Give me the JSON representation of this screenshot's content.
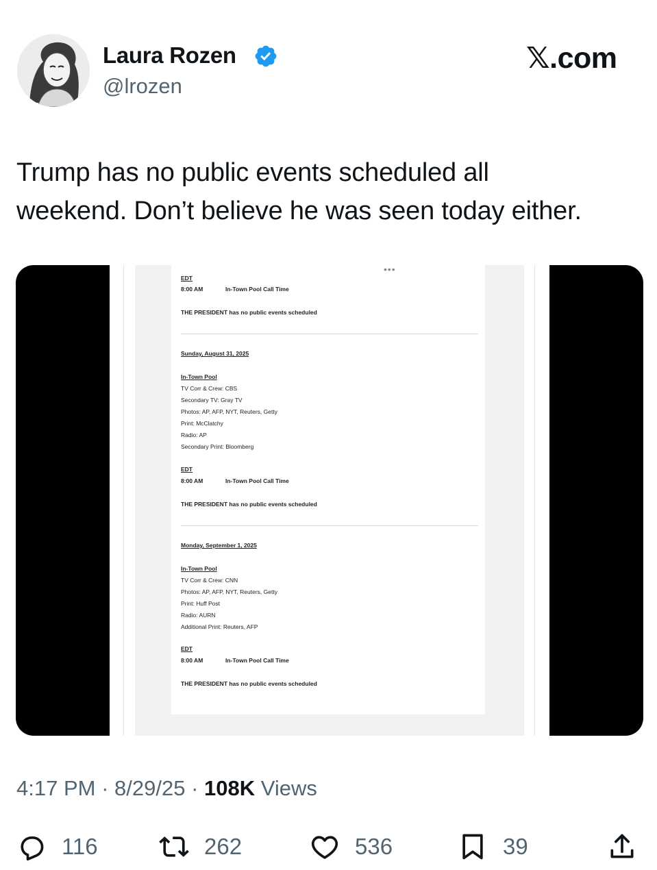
{
  "author": {
    "name": "Laura Rozen",
    "handle": "@lrozen",
    "verified_color": "#1d9bf0"
  },
  "brand": "𝕏.com",
  "tweet": {
    "text_line1": "Trump has no public events scheduled all",
    "text_line2": "weekend. Don’t believe he was seen today either."
  },
  "document": {
    "top": {
      "tz": "EDT",
      "time": "8:00 AM",
      "event": "In-Town Pool Call Time",
      "status": "THE PRESIDENT has no public events scheduled"
    },
    "sunday": {
      "date": "Sunday, August 31, 2025",
      "pool": "In-Town Pool",
      "lines": [
        "TV Corr & Crew: CBS",
        "Secondary TV: Gray TV",
        "Photos: AP, AFP, NYT, Reuters, Getty",
        "Print: McClatchy",
        "Radio: AP",
        "Secondary Print: Bloomberg"
      ],
      "tz": "EDT",
      "time": "8:00 AM",
      "event": "In-Town Pool Call Time",
      "status": "THE PRESIDENT has no public events scheduled"
    },
    "monday": {
      "date": "Monday, September 1, 2025",
      "pool": "In-Town Pool",
      "lines": [
        "TV Corr & Crew: CNN",
        "Photos: AP, AFP, NYT, Reuters, Getty",
        "Print: Huff Post",
        "Radio: AURN",
        "Additional Print: Reuters, AFP"
      ],
      "tz": "EDT",
      "time": "8:00 AM",
      "event": "In-Town Pool Call Time",
      "status": "THE PRESIDENT has no public events scheduled"
    },
    "menu_dots": "•••"
  },
  "meta": {
    "time": "4:17 PM",
    "date": "8/29/25",
    "views_count": "108K",
    "views_label": "Views",
    "separator": "·"
  },
  "actions": {
    "replies": "116",
    "reposts": "262",
    "likes": "536",
    "bookmarks": "39"
  }
}
